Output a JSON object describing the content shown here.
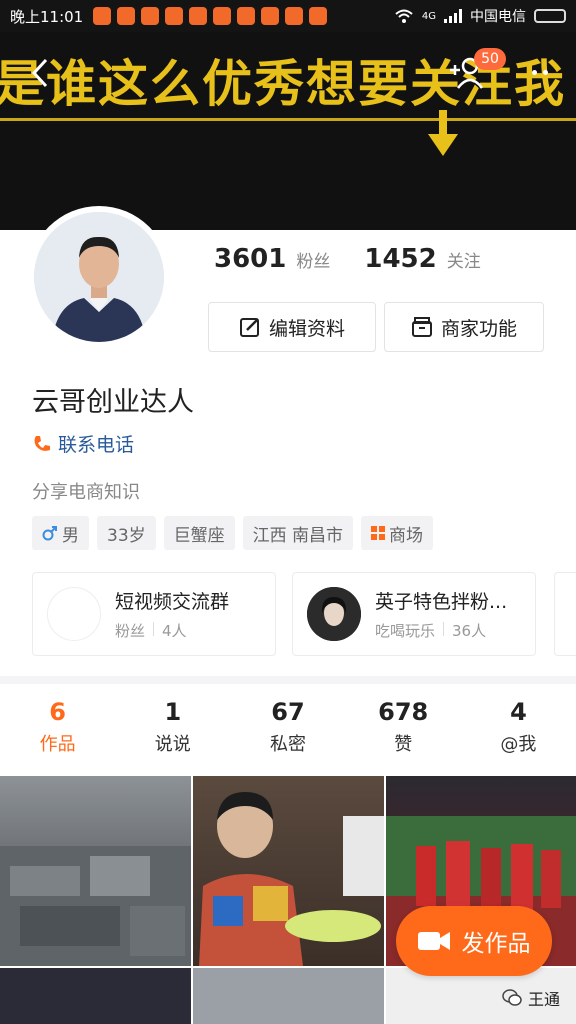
{
  "status_bar": {
    "time": "晚上11:01",
    "network": "4G",
    "carrier": "中国电信"
  },
  "cover": {
    "banner_text": "是谁这么优秀想要关注我",
    "follow_badge": "50"
  },
  "profile": {
    "fans_count": "3601",
    "fans_label": "粉丝",
    "following_count": "1452",
    "following_label": "关注",
    "edit_button": "编辑资料",
    "shop_button": "商家功能",
    "name": "云哥创业达人",
    "contact": "联系电话",
    "bio": "分享电商知识",
    "tags": [
      "男",
      "33岁",
      "巨蟹座",
      "江西 南昌市",
      "商场"
    ]
  },
  "groups": [
    {
      "title": "短视频交流群",
      "category": "粉丝",
      "members": "4人"
    },
    {
      "title": "英子特色拌粉...",
      "category": "吃喝玩乐",
      "members": "36人"
    }
  ],
  "tabs": [
    {
      "num": "6",
      "label": "作品"
    },
    {
      "num": "1",
      "label": "说说"
    },
    {
      "num": "67",
      "label": "私密"
    },
    {
      "num": "678",
      "label": "赞"
    },
    {
      "num": "4",
      "label": "@我"
    }
  ],
  "publish_button": "发作品",
  "watermark": "王通",
  "colors": {
    "accent": "#ff6a1a",
    "link": "#2a5a9a",
    "banner": "#e7c01a"
  }
}
